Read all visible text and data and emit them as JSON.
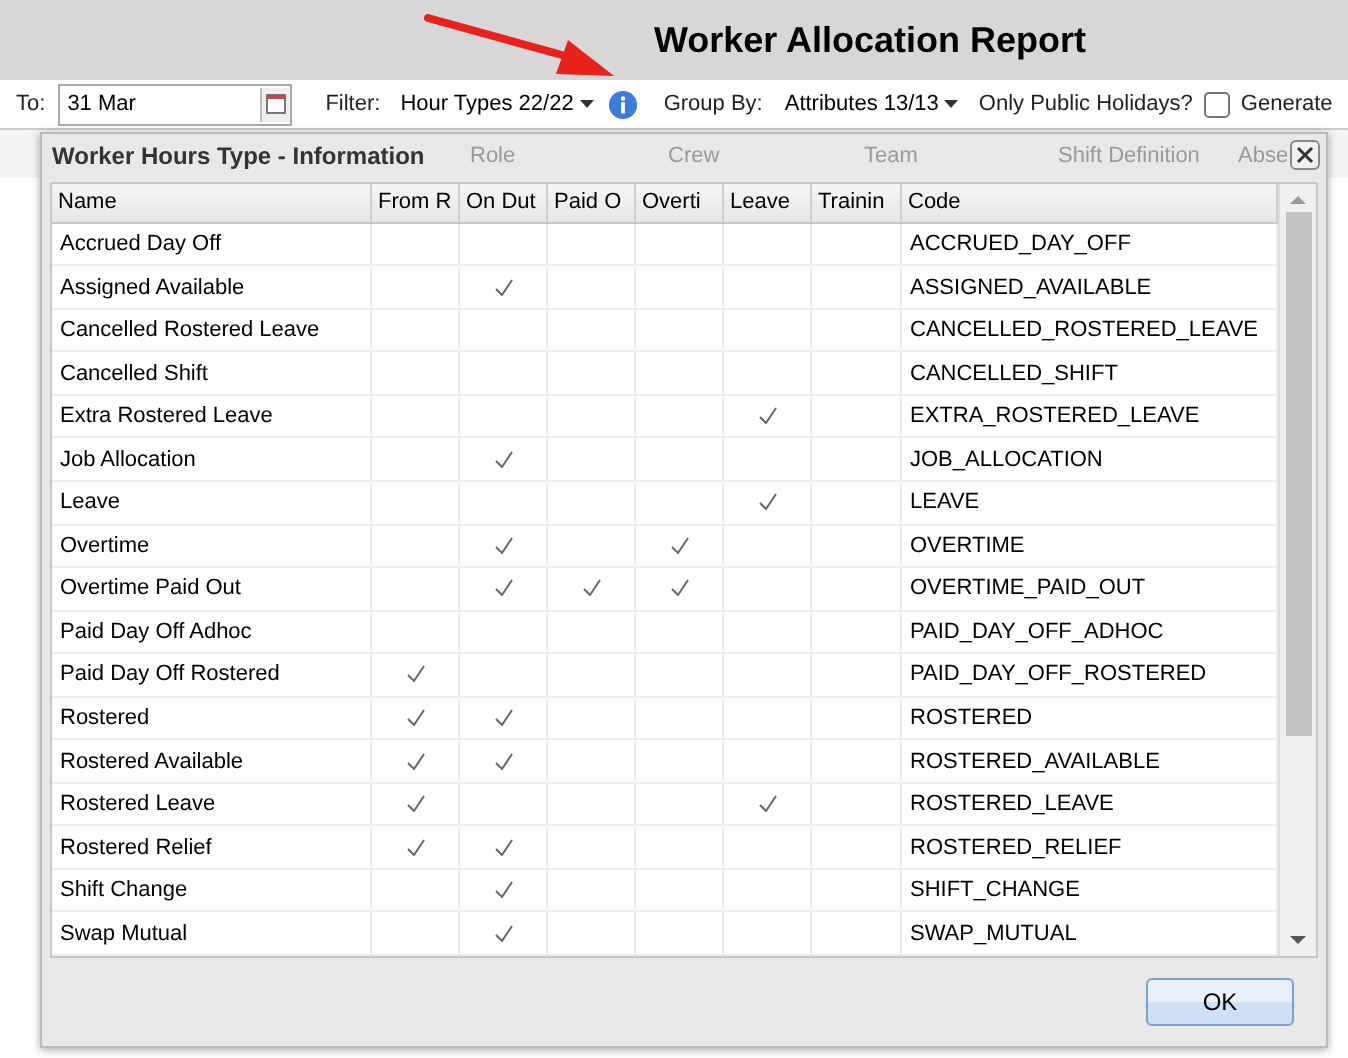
{
  "header": {
    "title": "Worker Allocation Report"
  },
  "toolbar": {
    "to_label": "To:",
    "to_value": "31 Mar",
    "filter_label": "Filter:",
    "hour_types": "Hour Types 22/22",
    "group_by_label": "Group By:",
    "attributes": "Attributes 13/13",
    "public_holidays_label": "Only Public Holidays?",
    "public_holidays_checked": false,
    "generate_label": "Generate"
  },
  "background_columns": [
    "Role",
    "Crew",
    "Team",
    "Shift Definition",
    "Abse"
  ],
  "dialog": {
    "title": "Worker Hours Type - Information",
    "columns": [
      "Name",
      "From R",
      "On Dut",
      "Paid O",
      "Overti",
      "Leave",
      "Trainin",
      "Code"
    ],
    "rows": [
      {
        "name": "Accrued Day Off",
        "flags": [
          false,
          false,
          false,
          false,
          false,
          false
        ],
        "code": "ACCRUED_DAY_OFF"
      },
      {
        "name": "Assigned Available",
        "flags": [
          false,
          true,
          false,
          false,
          false,
          false
        ],
        "code": "ASSIGNED_AVAILABLE"
      },
      {
        "name": "Cancelled Rostered Leave",
        "flags": [
          false,
          false,
          false,
          false,
          false,
          false
        ],
        "code": "CANCELLED_ROSTERED_LEAVE"
      },
      {
        "name": "Cancelled Shift",
        "flags": [
          false,
          false,
          false,
          false,
          false,
          false
        ],
        "code": "CANCELLED_SHIFT"
      },
      {
        "name": "Extra Rostered Leave",
        "flags": [
          false,
          false,
          false,
          false,
          true,
          false
        ],
        "code": "EXTRA_ROSTERED_LEAVE"
      },
      {
        "name": "Job Allocation",
        "flags": [
          false,
          true,
          false,
          false,
          false,
          false
        ],
        "code": "JOB_ALLOCATION"
      },
      {
        "name": "Leave",
        "flags": [
          false,
          false,
          false,
          false,
          true,
          false
        ],
        "code": "LEAVE"
      },
      {
        "name": "Overtime",
        "flags": [
          false,
          true,
          false,
          true,
          false,
          false
        ],
        "code": "OVERTIME"
      },
      {
        "name": "Overtime Paid Out",
        "flags": [
          false,
          true,
          true,
          true,
          false,
          false
        ],
        "code": "OVERTIME_PAID_OUT"
      },
      {
        "name": "Paid Day Off Adhoc",
        "flags": [
          false,
          false,
          false,
          false,
          false,
          false
        ],
        "code": "PAID_DAY_OFF_ADHOC"
      },
      {
        "name": "Paid Day Off Rostered",
        "flags": [
          true,
          false,
          false,
          false,
          false,
          false
        ],
        "code": "PAID_DAY_OFF_ROSTERED"
      },
      {
        "name": "Rostered",
        "flags": [
          true,
          true,
          false,
          false,
          false,
          false
        ],
        "code": "ROSTERED"
      },
      {
        "name": "Rostered Available",
        "flags": [
          true,
          true,
          false,
          false,
          false,
          false
        ],
        "code": "ROSTERED_AVAILABLE"
      },
      {
        "name": "Rostered Leave",
        "flags": [
          true,
          false,
          false,
          false,
          true,
          false
        ],
        "code": "ROSTERED_LEAVE"
      },
      {
        "name": "Rostered Relief",
        "flags": [
          true,
          true,
          false,
          false,
          false,
          false
        ],
        "code": "ROSTERED_RELIEF"
      },
      {
        "name": "Shift Change",
        "flags": [
          false,
          true,
          false,
          false,
          false,
          false
        ],
        "code": "SHIFT_CHANGE"
      },
      {
        "name": "Swap Mutual",
        "flags": [
          false,
          true,
          false,
          false,
          false,
          false
        ],
        "code": "SWAP_MUTUAL"
      }
    ],
    "ok_button": "OK"
  }
}
